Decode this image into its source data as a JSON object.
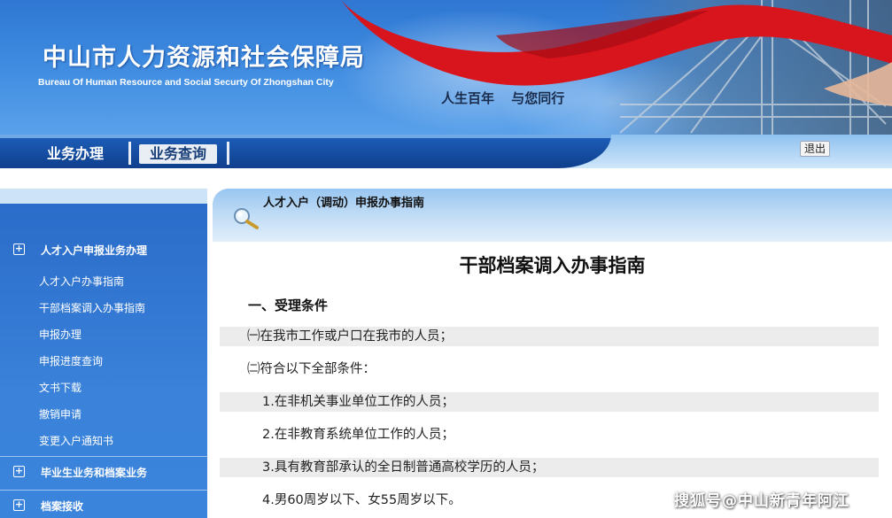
{
  "header": {
    "org_name_cn": "中山市人力资源和社会保障局",
    "org_name_en": "Bureau Of Human Resource and Social Securty Of Zhongshan City",
    "slogan": "人生百年   与您同行"
  },
  "nav": {
    "tabs": [
      {
        "label": "业务办理",
        "active": false
      },
      {
        "label": "业务查询",
        "active": true
      }
    ],
    "logout_label": "退出"
  },
  "sidebar": {
    "groups": [
      {
        "label": "人才入户申报业务办理",
        "icon": "plus-box-icon"
      },
      {
        "label": "毕业生业务和档案业务",
        "icon": "plus-box-icon"
      },
      {
        "label": "档案接收",
        "icon": "plus-box-icon"
      }
    ],
    "items": [
      "人才入户办事指南",
      "干部档案调入办事指南",
      "申报办理",
      "申报进度查询",
      "文书下载",
      "撤销申请",
      "变更入户通知书"
    ]
  },
  "panel": {
    "title": "人才入户（调动）申报办事指南",
    "icon": "magnifier-icon"
  },
  "document": {
    "title": "干部档案调入办事指南",
    "section1": "一、受理条件",
    "lines": [
      "㈠在我市工作或户口在我市的人员；",
      "㈡符合以下全部条件：",
      "1.在非机关事业单位工作的人员；",
      "2.在非教育系统单位工作的人员；",
      "3.具有教育部承认的全日制普通高校学历的人员；",
      "4.男60周岁以下、女55周岁以下。"
    ]
  },
  "watermark": "搜狐号@中山新青年阿江",
  "colors": {
    "banner_blue": "#2f77d2",
    "nav_dark": "#0f3f8c",
    "sidebar_blue": "#2f74cf",
    "ribbon_red": "#d8141c",
    "row_shade": "#ececec"
  }
}
